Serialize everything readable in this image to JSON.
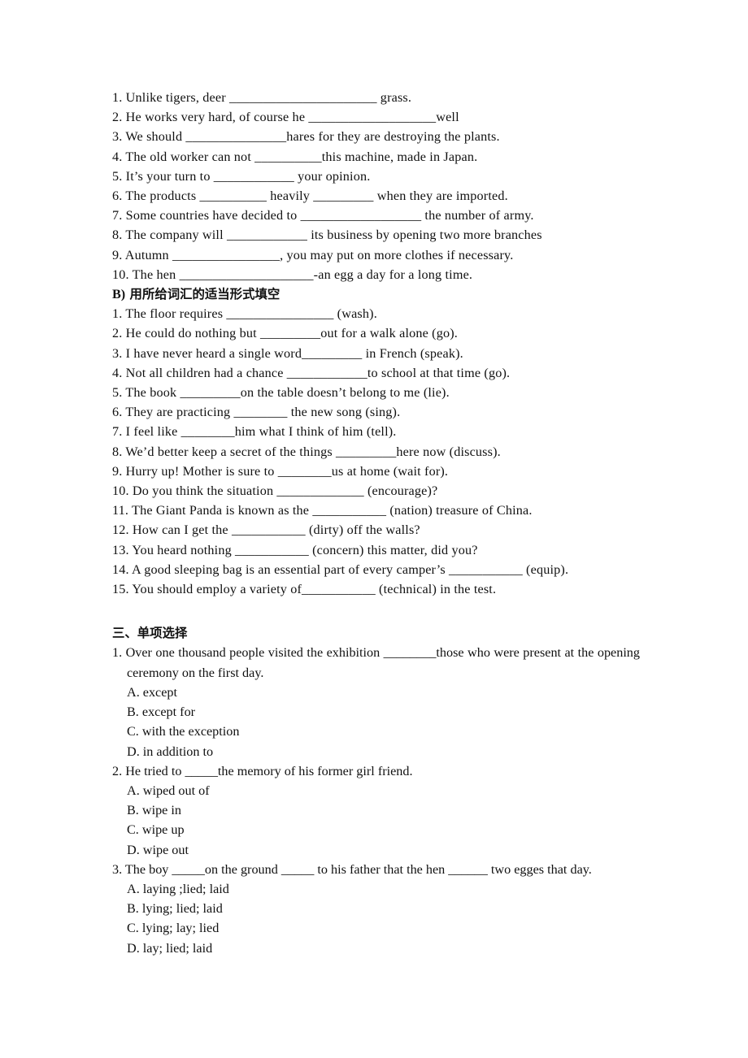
{
  "document": {
    "sections": [
      {
        "id": "section-a-fill",
        "lines": [
          "1. Unlike tigers, deer ______________________ grass.",
          "2. He works very hard, of course he ___________________well",
          "3. We should _______________hares for they are destroying the plants.",
          "4. The old worker can not __________this machine, made in Japan.",
          "5. It’s your turn to ____________ your opinion.",
          "6. The products __________ heavily _________ when they are imported.",
          "7. Some countries have decided to __________________ the number of army.",
          "8. The company will ____________ its business by opening two more branches",
          "9. Autumn ________________, you may put on more clothes if necessary.",
          "10. The hen ____________________-an egg a day for a long time."
        ]
      },
      {
        "id": "section-b",
        "heading": {
          "label": "B)",
          "title": "用所给词汇的适当形式填空"
        },
        "lines": [
          "1. The floor requires ________________ (wash).",
          "2. He could do nothing but _________out for a walk alone (go).",
          "3. I have never heard a single word_________ in French (speak).",
          "4. Not all children had a chance ____________to school at that time (go).",
          "5. The book _________on the table doesn’t belong to me (lie).",
          "6. They are practicing ________ the new song (sing).",
          "7. I feel like ________him what I think of him (tell).",
          "8. We’d better keep a secret of the things _________here now (discuss).",
          "9. Hurry up! Mother is sure to ________us at home (wait for).",
          "10. Do you think the situation _____________ (encourage)?",
          "11. The Giant Panda is known as the ___________ (nation) treasure of China.",
          "12. How can I get the ___________ (dirty) off the walls?",
          "13. You heard nothing ___________ (concern) this matter, did you?",
          "14. A good sleeping bag is an essential part of every camper’s ___________ (equip).",
          "15. You should employ a variety of___________ (technical) in the test."
        ]
      },
      {
        "id": "section-three-multiple-choice",
        "heading": "三、单项选择",
        "questions": [
          {
            "stem": "1. Over one thousand people visited the exhibition ________those who were present at the opening ceremony on the first day.",
            "options": [
              "A. except",
              "B. except for",
              "C. with the exception",
              "D. in addition to"
            ]
          },
          {
            "stem": "2. He tried to _____the memory of his former girl friend.",
            "options": [
              "A. wiped out of",
              "B. wipe in",
              "C. wipe up",
              "D. wipe out"
            ]
          },
          {
            "stem": "3. The boy _____on the ground _____ to his father that the hen ______ two egges that day.",
            "options": [
              "A. laying ;lied; laid",
              "B. lying; lied; laid",
              "C. lying; lay; lied",
              "D. lay; lied; laid"
            ]
          }
        ]
      }
    ]
  },
  "colors": {
    "page_background": "#ffffff",
    "text": "#111111"
  }
}
